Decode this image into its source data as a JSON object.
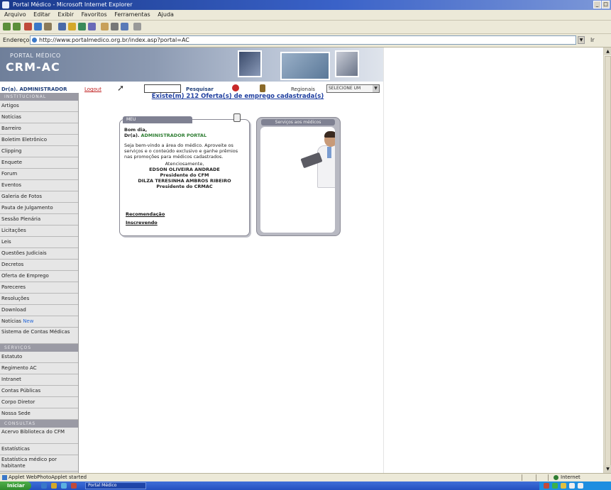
{
  "window": {
    "title": "Portal Médico - Microsoft Internet Explorer"
  },
  "menu": [
    "Arquivo",
    "Editar",
    "Exibir",
    "Favoritos",
    "Ferramentas",
    "Ajuda"
  ],
  "address": {
    "label": "Endereço",
    "url": "http://www.portalmedico.org.br/index.asp?portal=AC",
    "go_label": "Ir"
  },
  "banner": {
    "portal_label": "PORTAL MÉDICO",
    "logo": "CRM-AC"
  },
  "userbar": {
    "user": "Dr(a). ADMINISTRADOR",
    "logout": "Logout",
    "search_button": "Pesquisar",
    "regional_label": "Regionais",
    "regional_value": "SELECIONE UM"
  },
  "sidebar": {
    "section1": "INSTITUCIONAL",
    "items": [
      "Artigos",
      "Notícias",
      "Barreiro",
      "Boletim Eletrônico",
      "Clipping",
      "Enquete",
      "Forum",
      "Eventos",
      "Galeria de Fotos",
      "Pauta de Julgamento",
      "Sessão Plenária",
      "Licitações",
      "Leis",
      "Questões Judiciais",
      "Decretos",
      "Oferta de Emprego",
      "Pareceres",
      "Resoluções",
      "Download",
      "Notícias"
    ],
    "new_badge": "New",
    "item_tall": "Sistema de Contas Médicas",
    "section2": "SERVIÇOS",
    "items2": [
      "Estatuto",
      "Regimento AC",
      "Intranet",
      "Contas Públicas",
      "Corpo Diretor",
      "Nossa Sede"
    ],
    "section3": "CONSULTAS",
    "item_tall2": "Acervo Biblioteca do CFM",
    "items3": [
      "Estatísticas"
    ],
    "item_tall3": "Estatística médico por habitante"
  },
  "main": {
    "link": "Existe(m) 212 Oferta(s) de emprego cadastrada(s)",
    "welcome_tab": "MEU",
    "greeting": "Bom dia,",
    "user_prefix": "Dr(a).",
    "user_name": "ADMINISTRADOR PORTAL",
    "intro": "Seja bem-vindo a área do médico. Aproveite os serviços e o conteúdo exclusivo e ganhe prêmios nas promoções para médicos cadastrados.",
    "regards": "Atenciosamente,",
    "sig1_name": "EDSON OLIVEIRA ANDRADE",
    "sig1_title": "Presidente do CFM",
    "sig2_name": "DILZA TERESINHA AMBROS RIBEIRO",
    "sig2_title": "Presidente do CRMAC",
    "link1": "Recomendação",
    "link2": "Inscrevendo",
    "servicos_tab": "Serviços aos médicos"
  },
  "status": {
    "text": "Applet WebPhotoApplet started",
    "zone": "Internet"
  },
  "taskbar": {
    "start": "Iniciar",
    "task": "Portal Médico"
  }
}
